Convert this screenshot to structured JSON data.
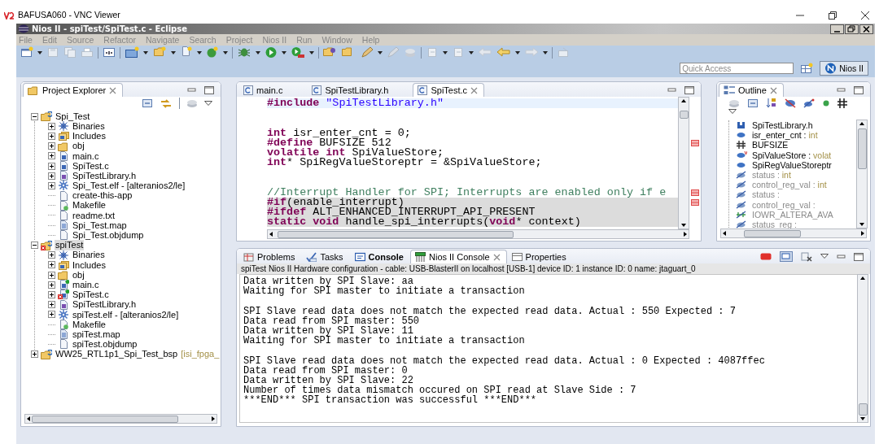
{
  "vnc_window": {
    "title": "BAFUSA060 - VNC Viewer"
  },
  "window": {
    "title": "Nios II - spiTest/SpiTest.c - Eclipse"
  },
  "menu": [
    "File",
    "Edit",
    "Source",
    "Refactor",
    "Navigate",
    "Search",
    "Project",
    "Nios II",
    "Run",
    "Window",
    "Help"
  ],
  "toolbar": {
    "quick_access": {
      "placeholder": "Quick Access"
    },
    "perspective": {
      "label": "Nios II",
      "selected": true
    }
  },
  "project_explorer": {
    "title": "Project Explorer",
    "tree": [
      {
        "label": "Spi_Test",
        "kind": "project",
        "expanded": true,
        "selected": false,
        "error": false,
        "synced": false,
        "children": [
          {
            "label": "Binaries",
            "kind": "binaries",
            "expanded": false,
            "selected": false,
            "error": false,
            "synced": false
          },
          {
            "label": "Includes",
            "kind": "includes",
            "expanded": false,
            "selected": false,
            "error": false,
            "synced": false
          },
          {
            "label": "obj",
            "kind": "folder",
            "expanded": false,
            "selected": false,
            "error": false,
            "synced": false
          },
          {
            "label": "main.c",
            "kind": "c-file",
            "expanded": false,
            "selected": false,
            "error": false,
            "synced": false
          },
          {
            "label": "SpiTest.c",
            "kind": "c-file",
            "expanded": false,
            "selected": false,
            "error": false,
            "synced": false
          },
          {
            "label": "SpiTestLibrary.h",
            "kind": "h-file",
            "expanded": false,
            "selected": false,
            "error": false,
            "synced": false
          },
          {
            "label": "Spi_Test.elf - [alteranios2/le]",
            "kind": "elf",
            "expanded": false,
            "selected": false,
            "error": false,
            "synced": false
          },
          {
            "label": "create-this-app",
            "kind": "file",
            "selected": false,
            "error": false,
            "synced": false
          },
          {
            "label": "Makefile",
            "kind": "makefile",
            "selected": false,
            "error": false,
            "synced": false
          },
          {
            "label": "readme.txt",
            "kind": "file",
            "selected": false,
            "error": false,
            "synced": false
          },
          {
            "label": "Spi_Test.map",
            "kind": "map",
            "selected": false,
            "error": false,
            "synced": false
          },
          {
            "label": "Spi_Test.objdump",
            "kind": "file",
            "selected": false,
            "error": false,
            "synced": false
          }
        ]
      },
      {
        "label": "spiTest",
        "kind": "project",
        "expanded": true,
        "selected": true,
        "error": true,
        "synced": false,
        "children": [
          {
            "label": "Binaries",
            "kind": "binaries",
            "expanded": false,
            "selected": false,
            "error": false,
            "synced": false
          },
          {
            "label": "Includes",
            "kind": "includes",
            "expanded": false,
            "selected": false,
            "error": false,
            "synced": false
          },
          {
            "label": "obj",
            "kind": "folder",
            "expanded": false,
            "selected": false,
            "error": false,
            "synced": false
          },
          {
            "label": "main.c",
            "kind": "c-file",
            "expanded": false,
            "selected": false,
            "error": false,
            "synced": true
          },
          {
            "label": "SpiTest.c",
            "kind": "c-file",
            "expanded": false,
            "selected": false,
            "error": true,
            "synced": true
          },
          {
            "label": "SpiTestLibrary.h",
            "kind": "h-file",
            "expanded": false,
            "selected": false,
            "error": false,
            "synced": false
          },
          {
            "label": "spiTest.elf - [alteranios2/le]",
            "kind": "elf",
            "expanded": false,
            "selected": false,
            "error": false,
            "synced": false
          },
          {
            "label": "Makefile",
            "kind": "makefile",
            "selected": false,
            "error": false,
            "synced": false
          },
          {
            "label": "spiTest.map",
            "kind": "map",
            "selected": false,
            "error": false,
            "synced": false
          },
          {
            "label": "spiTest.objdump",
            "kind": "file",
            "selected": false,
            "error": false,
            "synced": false
          }
        ]
      },
      {
        "label": "WW25_RTL1p1_Spi_Test_bsp",
        "target": "[isi_fpga_",
        "kind": "project",
        "expanded": false,
        "selected": false,
        "error": false,
        "synced": false
      }
    ]
  },
  "editor": {
    "tabs": [
      {
        "label": "main.c",
        "selected": false
      },
      {
        "label": "SpiTestLibrary.h",
        "selected": false
      },
      {
        "label": "SpiTest.c",
        "selected": true
      }
    ],
    "blocks": [
      [
        {
          "current_line": true,
          "inactive": false,
          "marker": false,
          "tokens": [
            {
              "kind": "keyword",
              "text": "#include"
            },
            {
              "kind": "string",
              "text": " \"SpiTestLibrary.h\""
            }
          ]
        }
      ],
      [
        {
          "current_line": false,
          "inactive": false,
          "marker": false,
          "tokens": [
            {
              "kind": "keyword",
              "text": "int"
            },
            {
              "kind": "plain",
              "text": " isr_enter_cnt = 0;"
            }
          ]
        },
        {
          "current_line": false,
          "inactive": false,
          "marker": true,
          "tokens": [
            {
              "kind": "keyword",
              "text": "#define"
            },
            {
              "kind": "plain",
              "text": " BUFSIZE 512"
            }
          ]
        },
        {
          "current_line": false,
          "inactive": false,
          "marker": false,
          "tokens": [
            {
              "kind": "keyword",
              "text": "volatile"
            },
            {
              "kind": "keyword",
              "text": " int"
            },
            {
              "kind": "plain",
              "text": " SpiValueStore;"
            }
          ]
        },
        {
          "current_line": false,
          "inactive": false,
          "marker": false,
          "tokens": [
            {
              "kind": "keyword",
              "text": "int"
            },
            {
              "kind": "plain",
              "text": "* SpiRegValueStoreptr = &SpiValueStore;"
            }
          ]
        }
      ],
      [
        {
          "current_line": false,
          "inactive": false,
          "marker": true,
          "tokens": [
            {
              "kind": "comment",
              "text": "//Interrupt Handler for SPI; Interrupts are enabled only if e"
            }
          ]
        },
        {
          "current_line": false,
          "inactive": true,
          "marker": true,
          "tokens": [
            {
              "kind": "keyword",
              "text": "#if"
            },
            {
              "kind": "plain",
              "text": "(enable_interrupt)"
            }
          ]
        },
        {
          "current_line": false,
          "inactive": true,
          "marker": false,
          "tokens": [
            {
              "kind": "keyword",
              "text": "#ifdef"
            },
            {
              "kind": "plain",
              "text": " ALT_ENHANCED_INTERRUPT_API_PRESENT"
            }
          ]
        },
        {
          "current_line": false,
          "inactive": true,
          "marker": false,
          "tokens": [
            {
              "kind": "keyword",
              "text": "static"
            },
            {
              "kind": "keyword",
              "text": " void"
            },
            {
              "kind": "plain",
              "text": " handle_spi_interrupts("
            },
            {
              "kind": "keyword",
              "text": "void"
            },
            {
              "kind": "plain",
              "text": "* context)"
            }
          ]
        }
      ]
    ]
  },
  "outline": {
    "title": "Outline",
    "items": [
      {
        "name": "SpiTestLibrary.h",
        "kind": "include"
      },
      {
        "name": "isr_enter_cnt :",
        "type": "int",
        "kind": "variable"
      },
      {
        "name": "BUFSIZE",
        "kind": "macro"
      },
      {
        "name": "SpiValueStore :",
        "type": "volat",
        "kind": "volatile-variable"
      },
      {
        "name": "SpiRegValueStoreptr",
        "kind": "variable"
      },
      {
        "name": "status :",
        "type": "int",
        "kind": "inactive-variable"
      },
      {
        "name": "control_reg_val :",
        "type": "int",
        "kind": "inactive-variable"
      },
      {
        "name": "status :",
        "kind": "inactive-variable"
      },
      {
        "name": "control_reg_val :",
        "kind": "inactive-variable"
      },
      {
        "name": "IOWR_ALTERA_AVA",
        "kind": "inactive-call"
      },
      {
        "name": "status_reg :",
        "kind": "inactive-variable"
      }
    ]
  },
  "console_view": {
    "tabs": [
      {
        "label": "Problems",
        "kind": "problems",
        "selected": false,
        "bold": false
      },
      {
        "label": "Tasks",
        "kind": "tasks",
        "selected": false,
        "bold": false
      },
      {
        "label": "Console",
        "kind": "console",
        "selected": false,
        "bold": true
      },
      {
        "label": "Nios II Console",
        "kind": "nios-console",
        "selected": true,
        "bold": false
      },
      {
        "label": "Properties",
        "kind": "properties",
        "selected": false,
        "bold": false
      }
    ],
    "header": "spiTest Nios II Hardware configuration - cable: USB-BlasterII on localhost [USB-1] device ID: 1 instance ID: 0 name: jtaguart_0",
    "blocks": [
      [
        "Data written by SPI Slave: aa",
        "Waiting for SPI master to initiate a transaction"
      ],
      [
        "SPI Slave read data does not match the expected read data. Actual : 550 Expected : 7",
        "Data read from SPI master: 550",
        "Data written by SPI Slave: 11",
        "Waiting for SPI master to initiate a transaction"
      ],
      [
        "SPI Slave read data does not match the expected read data. Actual : 0 Expected : 4087ffec",
        "Data read from SPI master: 0",
        "Data written by SPI Slave: 22",
        "Number of times data mismatch occured on SPI read at Slave Side : 7",
        "***END*** SPI transaction was successful ***END***"
      ]
    ]
  }
}
